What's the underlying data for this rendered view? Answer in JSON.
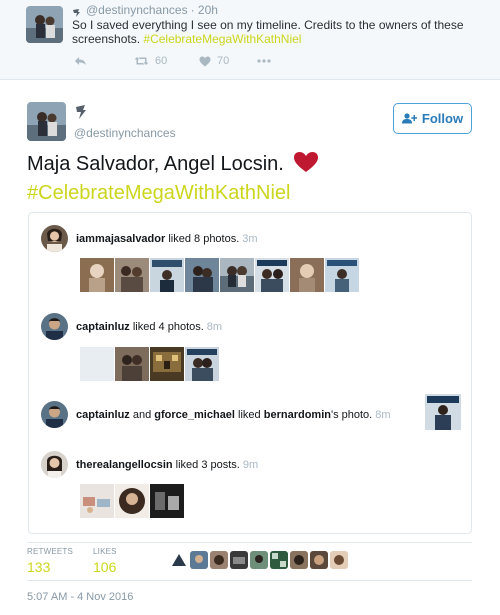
{
  "context_tweet": {
    "handle": "@destinynchances",
    "time": "· 20h",
    "text": "So I saved everything I see on my timeline. Credits to the owners of these screenshots.",
    "hashtag": "#CelebrateMegaWithKathNiel",
    "retweets": "60",
    "likes": "70"
  },
  "tweet": {
    "handle": "@destinynchances",
    "follow_label": "Follow",
    "text_line1": "Maja Salvador, Angel Locsin.",
    "hashtag": "#CelebrateMegaWithKathNiel",
    "retweets_label": "RETWEETS",
    "retweets": "133",
    "likes_label": "LIKES",
    "likes": "106",
    "timestamp": "5:07 AM - 4 Nov 2016"
  },
  "activity": [
    {
      "user": "iammajasalvador",
      "text": "liked 8 photos.",
      "time": "3m"
    },
    {
      "user": "captainluz",
      "text": "liked 4 photos.",
      "time": "8m"
    },
    {
      "user": "captainluz",
      "and": "and",
      "user2": "gforce_michael",
      "text": "liked",
      "target": "bernardomin",
      "suffix": "'s photo.",
      "time": "8m"
    },
    {
      "user": "therealangellocsin",
      "text": "liked 3 posts.",
      "time": "9m"
    }
  ],
  "colors": {
    "accent": "#ccd61d",
    "follow_blue": "#2b7bb9",
    "muted": "#8899a6",
    "heart_red": "#be1931"
  }
}
